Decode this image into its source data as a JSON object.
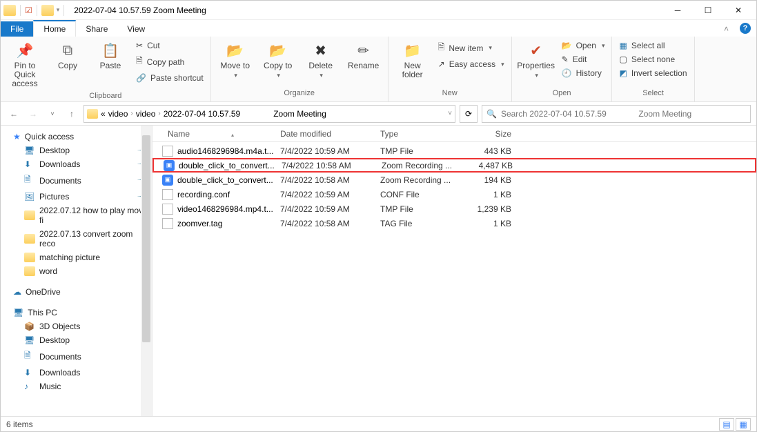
{
  "title": "2022-07-04 10.57.59          Zoom Meeting",
  "tabs": {
    "file": "File",
    "home": "Home",
    "share": "Share",
    "view": "View"
  },
  "ribbon": {
    "clipboard": {
      "pin": "Pin to Quick access",
      "copy": "Copy",
      "paste": "Paste",
      "cut": "Cut",
      "copypath": "Copy path",
      "pasteshortcut": "Paste shortcut",
      "label": "Clipboard"
    },
    "organize": {
      "moveto": "Move to",
      "copyto": "Copy to",
      "delete": "Delete",
      "rename": "Rename",
      "label": "Organize"
    },
    "new": {
      "newfolder": "New folder",
      "newitem": "New item",
      "easyaccess": "Easy access",
      "label": "New"
    },
    "open": {
      "properties": "Properties",
      "open": "Open",
      "edit": "Edit",
      "history": "History",
      "label": "Open"
    },
    "select": {
      "selectall": "Select all",
      "selectnone": "Select none",
      "invert": "Invert selection",
      "label": "Select"
    }
  },
  "breadcrumb": {
    "prefix": "«",
    "p1": "video",
    "p2": "video",
    "p3": "2022-07-04 10.57.59",
    "p4": "Zoom Meeting"
  },
  "search": {
    "placeholder": "Search 2022-07-04 10.57.59              Zoom Meeting"
  },
  "sidebar": {
    "quick": "Quick access",
    "items": [
      {
        "label": "Desktop",
        "pin": true
      },
      {
        "label": "Downloads",
        "pin": true
      },
      {
        "label": "Documents",
        "pin": true
      },
      {
        "label": "Pictures",
        "pin": true
      },
      {
        "label": "2022.07.12 how to play mov fi"
      },
      {
        "label": "2022.07.13 convert zoom reco"
      },
      {
        "label": "matching picture"
      },
      {
        "label": "word"
      }
    ],
    "onedrive": "OneDrive",
    "thispc": "This PC",
    "pcitems": [
      "3D Objects",
      "Desktop",
      "Documents",
      "Downloads",
      "Music"
    ]
  },
  "columns": {
    "name": "Name",
    "date": "Date modified",
    "type": "Type",
    "size": "Size"
  },
  "files": [
    {
      "name": "audio1468296984.m4a.t...",
      "date": "7/4/2022 10:59 AM",
      "type": "TMP File",
      "size": "443 KB",
      "icon": "doc"
    },
    {
      "name": "double_click_to_convert...",
      "date": "7/4/2022 10:58 AM",
      "type": "Zoom Recording ...",
      "size": "4,487 KB",
      "icon": "zoom",
      "highlight": true
    },
    {
      "name": "double_click_to_convert...",
      "date": "7/4/2022 10:58 AM",
      "type": "Zoom Recording ...",
      "size": "194 KB",
      "icon": "zoom"
    },
    {
      "name": "recording.conf",
      "date": "7/4/2022 10:59 AM",
      "type": "CONF File",
      "size": "1 KB",
      "icon": "doc"
    },
    {
      "name": "video1468296984.mp4.t...",
      "date": "7/4/2022 10:59 AM",
      "type": "TMP File",
      "size": "1,239 KB",
      "icon": "doc"
    },
    {
      "name": "zoomver.tag",
      "date": "7/4/2022 10:58 AM",
      "type": "TAG File",
      "size": "1 KB",
      "icon": "doc"
    }
  ],
  "status": {
    "count": "6 items"
  }
}
